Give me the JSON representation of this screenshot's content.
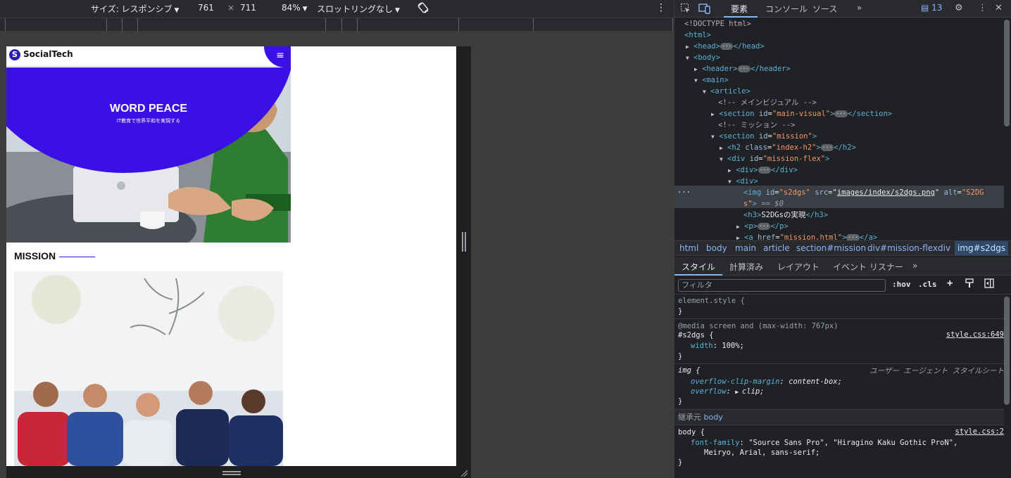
{
  "emulation": {
    "size_label": "サイズ: レスポンシブ",
    "width": "761",
    "times": "×",
    "height": "711",
    "zoom": "84%",
    "throttle": "スロットリングなし"
  },
  "site": {
    "logo_mark": "S",
    "logo_text": "SocialTech",
    "menu_icon": "≡",
    "hero_title": "WORD PEACE",
    "hero_subtitle": "IT教育で世界平和を実現する",
    "mission_title": "MISSION"
  },
  "devtools": {
    "tabs": [
      "要素",
      "コンソール",
      "ソース"
    ],
    "issues_count": "13",
    "dom_lines": [
      {
        "indent": 0,
        "html": "&lt;!DOCTYPE html&gt;",
        "kind": "cmt"
      },
      {
        "indent": 0,
        "tag_open": "<html>"
      },
      {
        "indent": 1,
        "collapsed": "head"
      },
      {
        "indent": 1,
        "open": "body"
      }
    ],
    "dom_text": {
      "doctype": "<!DOCTYPE html>",
      "html_open": "<html>",
      "head": "head",
      "body": "body",
      "header": "header",
      "main": "main",
      "article": "article",
      "comment_mv": "<!-- メインビジュアル -->",
      "section": "section",
      "id_attr": "id",
      "mv_id": "\"main-visual\"",
      "comment_mission": "<!-- ミッション -->",
      "mission_id": "\"mission\"",
      "h2": "h2",
      "class_attr": "class",
      "h2_class": "\"index-h2\"",
      "div": "div",
      "mf_id": "\"mission-flex\"",
      "img": "img",
      "img_id": "\"s2dgs\"",
      "src_attr": "src",
      "img_src": "images/index/s2dgs.png",
      "alt_attr": "alt",
      "img_alt_1": "\"S2DG",
      "img_alt_2": "s\"",
      "dollar": "== $0",
      "h3_text": "S2DGsの実現",
      "h3": "h3",
      "p": "p",
      "a": "a",
      "href_attr": "href",
      "a_href": "\"mission.html\""
    },
    "breadcrumbs": [
      "html",
      "body",
      "main",
      "article",
      "section#mission",
      "div#mission-flex",
      "div",
      "img#s2dgs"
    ],
    "subtabs": [
      "スタイル",
      "計算済み",
      "レイアウト",
      "イベント リスナー"
    ],
    "filter_placeholder": "フィルタ",
    "filter_tools": [
      ":hov",
      ".cls"
    ],
    "styles": {
      "element_style": "element.style {",
      "close": "}",
      "media": "@media screen and (max-width: 767px)",
      "rule1_selector": "#s2dgs {",
      "rule1_src": "style.css:649",
      "rule1_prop": "width",
      "rule1_val": "100%;",
      "rule2_selector": "img {",
      "rule2_src": "ユーザー エージェント スタイルシート",
      "rule2_prop1": "overflow-clip-margin",
      "rule2_val1": "content-box;",
      "rule2_prop2": "overflow",
      "rule2_val2": "clip;",
      "inherited_label": "継承元",
      "inherited_from": "body",
      "rule3_selector": "body {",
      "rule3_src": "style.css:2",
      "rule3_prop": "font-family",
      "rule3_val_1": "\"Source Sans Pro\", \"Hiragino Kaku Gothic ProN\",",
      "rule3_val_2": "Meiryo, Arial, sans-serif;"
    }
  },
  "colors": {
    "brand": "#3a10e5",
    "devtools_bg": "#202124",
    "tag": "#5db0d7",
    "attr_value": "#f29766"
  }
}
